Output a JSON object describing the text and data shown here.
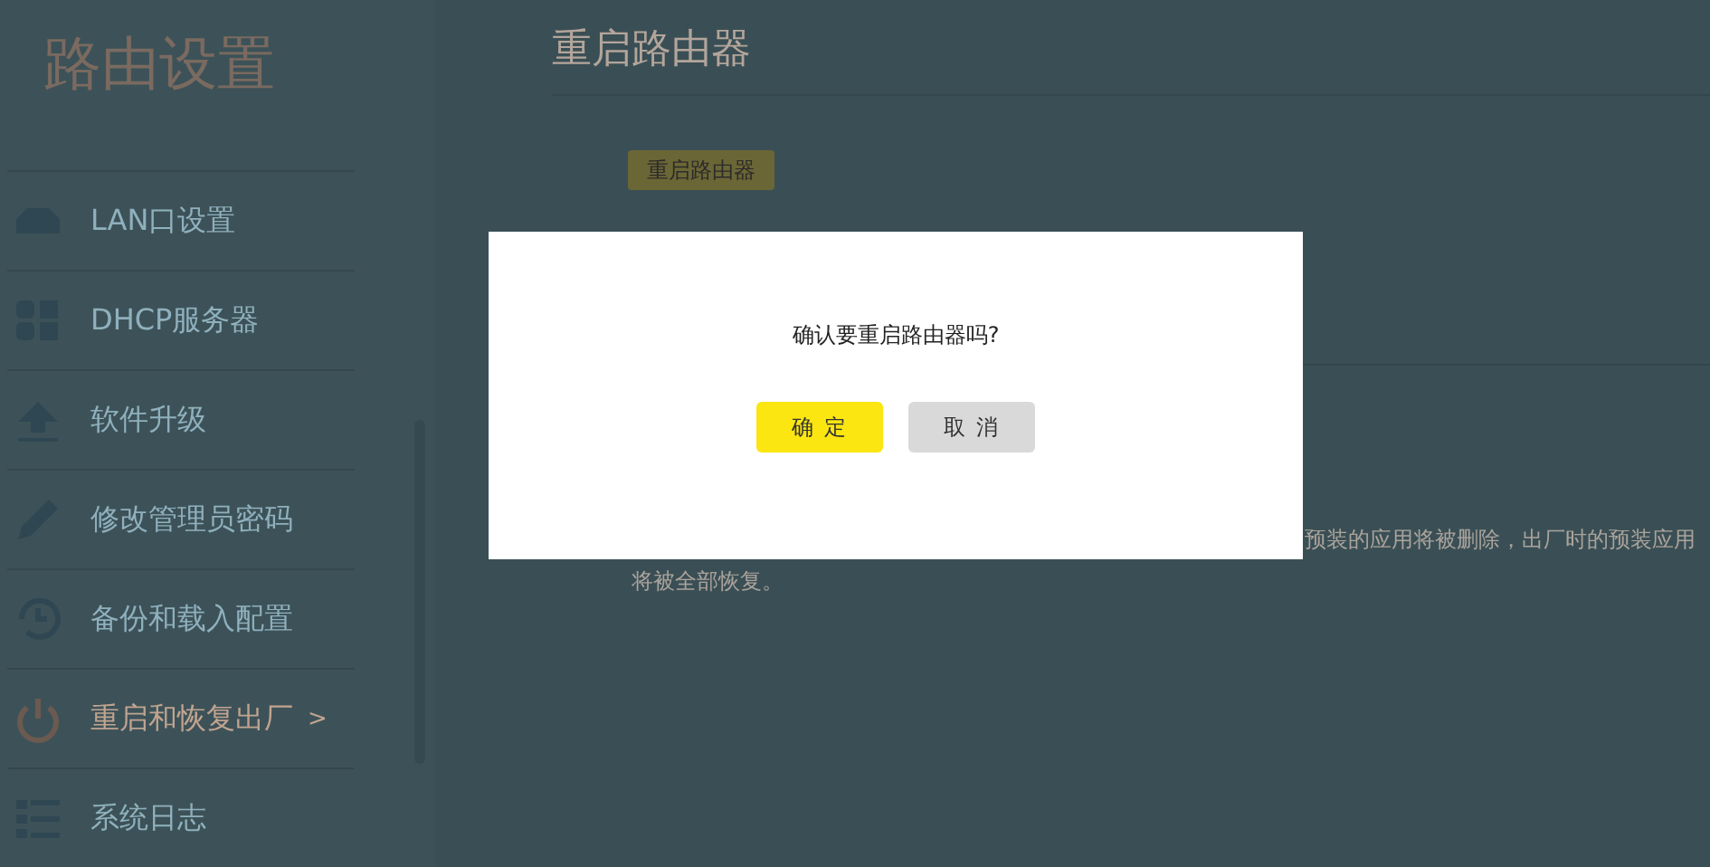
{
  "sidebar": {
    "title": "路由设置",
    "items": [
      {
        "label": "LAN口设置",
        "selected": false
      },
      {
        "label": "DHCP服务器",
        "selected": false
      },
      {
        "label": "软件升级",
        "selected": false
      },
      {
        "label": "修改管理员密码",
        "selected": false
      },
      {
        "label": "备份和载入配置",
        "selected": false
      },
      {
        "label": "重启和恢复出厂",
        "selected": true,
        "arrow": ">"
      },
      {
        "label": "系统日志",
        "selected": false
      }
    ]
  },
  "main": {
    "title": "重启路由器",
    "restart_button": "重启路由器",
    "note_lines": [
      "预装的应用将被删除，出厂时的预装应用",
      "将被全部恢复。"
    ]
  },
  "dialog": {
    "message": "确认要重启路由器吗?",
    "buttons": [
      {
        "label": "确 定",
        "kind": "primary"
      },
      {
        "label": "取 消",
        "kind": "secondary"
      }
    ]
  }
}
